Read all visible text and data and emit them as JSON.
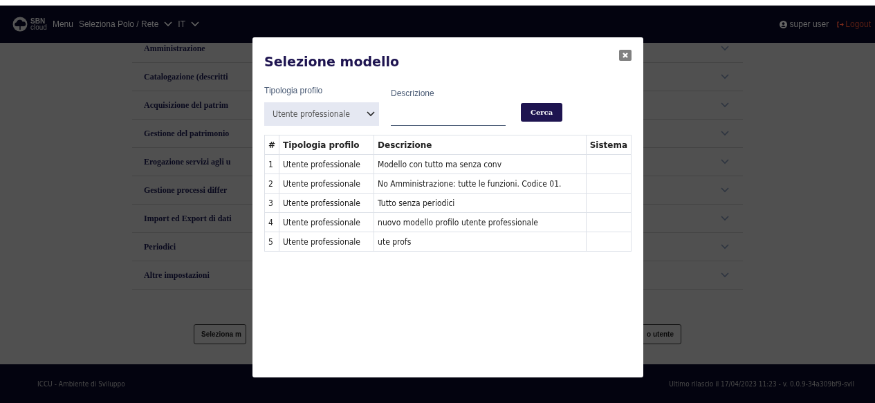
{
  "navbar": {
    "logo_text": "SBN",
    "logo_subtext": "cloud",
    "items": [
      {
        "label": "Menu",
        "dropdown": false
      },
      {
        "label": "Seleziona Polo / Rete",
        "dropdown": true
      },
      {
        "label": "IT",
        "dropdown": true
      }
    ],
    "user": "super user",
    "logout": "Logout"
  },
  "sections": [
    {
      "title": "Amministrazione"
    },
    {
      "title": "Catalogazione (descritti"
    },
    {
      "title": "Acquisizione del patrim"
    },
    {
      "title": "Gestione del patrimonio"
    },
    {
      "title": "Erogazione servizi agli u"
    },
    {
      "title": "Gestione processi differ"
    },
    {
      "title": "Import ed Export di dati"
    },
    {
      "title": "Periodici"
    },
    {
      "title": "Altre impostazioni"
    }
  ],
  "buttons": [
    "Seleziona m",
    "o utente"
  ],
  "footer": {
    "left": "ICCU - Ambiente di Sviluppo",
    "right": "Ultimo rilascio il 17/04/2023 11:23 - v. 0.0.9-34a309bf9-svil"
  },
  "modal": {
    "title": "Selezione modello",
    "filters": {
      "profile_label": "Tipologia profilo",
      "profile_value": "Utente professionale",
      "description_label": "Descrizione",
      "search_button": "Cerca"
    },
    "table": {
      "columns": [
        "#",
        "Tipologia profilo",
        "Descrizione",
        "Sistema"
      ],
      "rows": [
        [
          "1",
          "Utente professionale",
          "Modello con tutto ma senza conv",
          ""
        ],
        [
          "2",
          "Utente professionale",
          "No Amministrazione: tutte le funzioni. Codice 01.",
          ""
        ],
        [
          "3",
          "Utente professionale",
          "Tutto senza periodici",
          ""
        ],
        [
          "4",
          "Utente professionale",
          "nuovo modello profilo utente professionale",
          ""
        ],
        [
          "5",
          "Utente professionale",
          "ute profs",
          ""
        ]
      ]
    }
  }
}
